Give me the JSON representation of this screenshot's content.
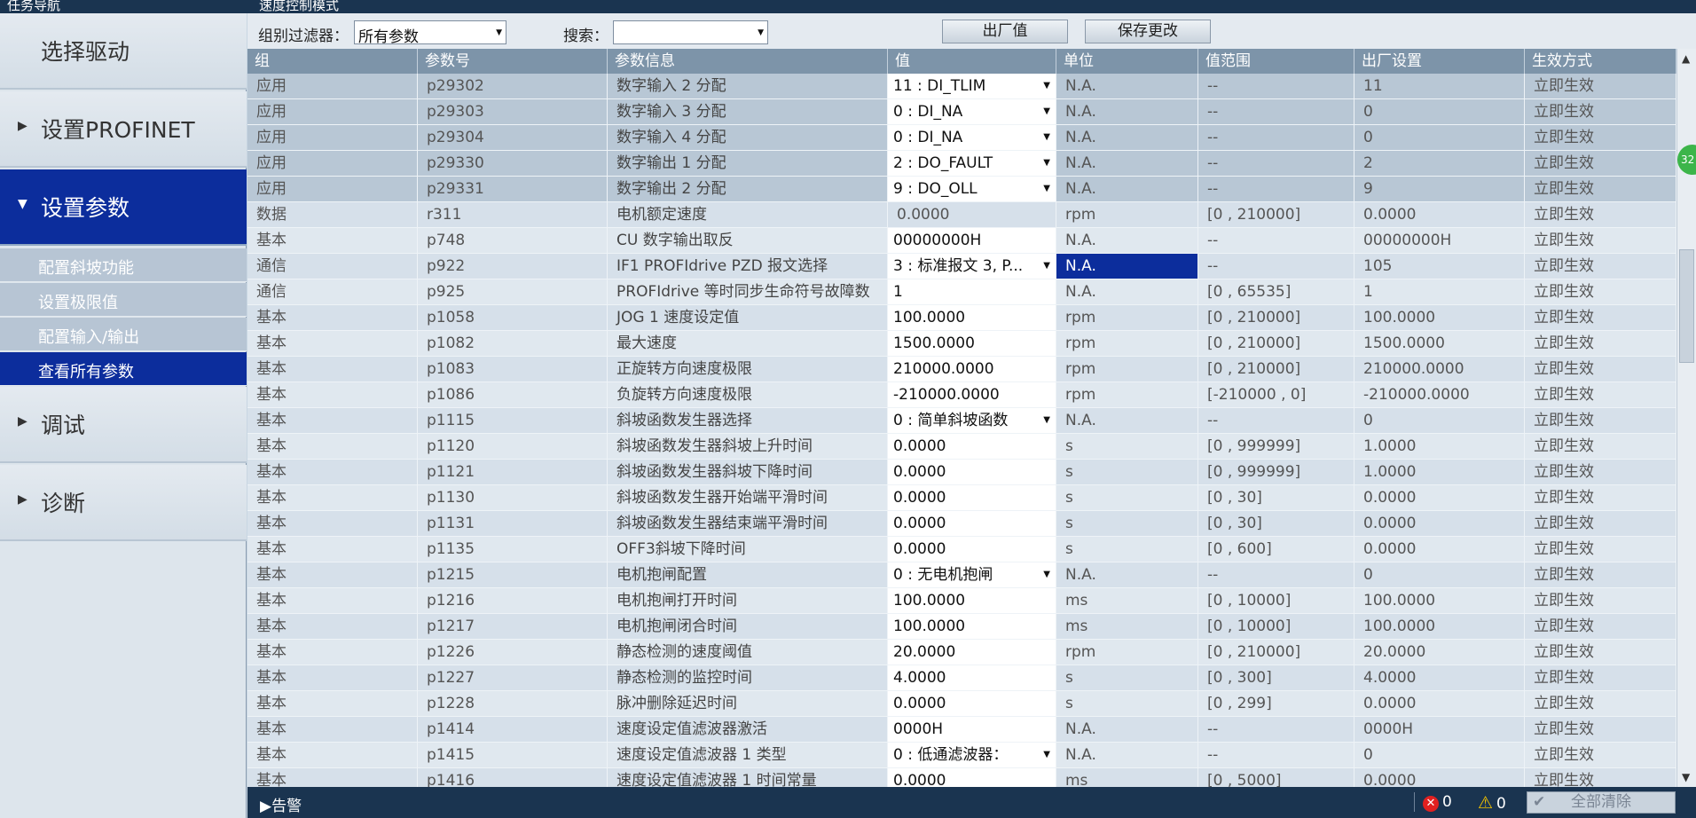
{
  "window": {
    "nav_title": "任务导航",
    "mode_title": "速度控制模式"
  },
  "nav": {
    "main": [
      {
        "label": "选择驱动",
        "arrow": ""
      },
      {
        "label": "设置PROFINET",
        "arrow": "▶"
      },
      {
        "label": "设置参数",
        "arrow": "▼"
      },
      {
        "label": "调试",
        "arrow": "▶"
      },
      {
        "label": "诊断",
        "arrow": "▶"
      }
    ],
    "sub": [
      {
        "label": "配置斜坡功能"
      },
      {
        "label": "设置极限值"
      },
      {
        "label": "配置输入/输出"
      },
      {
        "label": "查看所有参数"
      }
    ]
  },
  "toolbar": {
    "group_filter_label": "组别过滤器：",
    "group_filter_value": "所有参数",
    "search_label": "搜索：",
    "search_value": "",
    "factory_button": "出厂值",
    "save_button": "保存更改"
  },
  "table": {
    "headers": [
      "组",
      "参数号",
      "参数信息",
      "值",
      "单位",
      "值范围",
      "出厂设置",
      "生效方式"
    ],
    "rows": [
      {
        "group": "应用",
        "param": "p29302",
        "info": "数字输入 2 分配",
        "value": "11 : DI_TLIM",
        "combo": true,
        "unit": "N.A.",
        "range": "--",
        "factory": "11",
        "effect": "立即生效"
      },
      {
        "group": "应用",
        "param": "p29303",
        "info": "数字输入 3 分配",
        "value": "0 : DI_NA",
        "combo": true,
        "unit": "N.A.",
        "range": "--",
        "factory": "0",
        "effect": "立即生效"
      },
      {
        "group": "应用",
        "param": "p29304",
        "info": "数字输入 4 分配",
        "value": "0 : DI_NA",
        "combo": true,
        "unit": "N.A.",
        "range": "--",
        "factory": "0",
        "effect": "立即生效"
      },
      {
        "group": "应用",
        "param": "p29330",
        "info": "数字输出 1 分配",
        "value": "2 : DO_FAULT",
        "combo": true,
        "unit": "N.A.",
        "range": "--",
        "factory": "2",
        "effect": "立即生效"
      },
      {
        "group": "应用",
        "param": "p29331",
        "info": "数字输出 2 分配",
        "value": "9 : DO_OLL",
        "combo": true,
        "unit": "N.A.",
        "range": "--",
        "factory": "9",
        "effect": "立即生效"
      },
      {
        "group": "数据",
        "param": "r311",
        "info": "电机额定速度",
        "value": "0.0000",
        "combo": false,
        "readonly": true,
        "unit": "rpm",
        "range": "[0 , 210000]",
        "factory": "0.0000",
        "effect": "立即生效"
      },
      {
        "group": "基本",
        "param": "p748",
        "info": "CU 数字输出取反",
        "value": "00000000H",
        "combo": false,
        "unit": "N.A.",
        "range": "--",
        "factory": "00000000H",
        "effect": "立即生效"
      },
      {
        "group": "通信",
        "param": "p922",
        "info": "IF1 PROFIdrive PZD 报文选择",
        "value": "3 : 标准报文 3, P...",
        "combo": true,
        "unit": "N.A.",
        "unit_selected": true,
        "range": "--",
        "factory": "105",
        "effect": "立即生效"
      },
      {
        "group": "通信",
        "param": "p925",
        "info": "PROFIdrive 等时同步生命符号故障数",
        "value": "1",
        "combo": false,
        "unit": "N.A.",
        "range": "[0 , 65535]",
        "factory": "1",
        "effect": "立即生效"
      },
      {
        "group": "基本",
        "param": "p1058",
        "info": "JOG 1 速度设定值",
        "value": "100.0000",
        "combo": false,
        "unit": "rpm",
        "range": "[0 , 210000]",
        "factory": "100.0000",
        "effect": "立即生效"
      },
      {
        "group": "基本",
        "param": "p1082",
        "info": "最大速度",
        "value": "1500.0000",
        "combo": false,
        "unit": "rpm",
        "range": "[0 , 210000]",
        "factory": "1500.0000",
        "effect": "立即生效"
      },
      {
        "group": "基本",
        "param": "p1083",
        "info": "正旋转方向速度极限",
        "value": "210000.0000",
        "combo": false,
        "unit": "rpm",
        "range": "[0 , 210000]",
        "factory": "210000.0000",
        "effect": "立即生效"
      },
      {
        "group": "基本",
        "param": "p1086",
        "info": "负旋转方向速度极限",
        "value": "-210000.0000",
        "combo": false,
        "unit": "rpm",
        "range": "[-210000 , 0]",
        "factory": "-210000.0000",
        "effect": "立即生效"
      },
      {
        "group": "基本",
        "param": "p1115",
        "info": "斜坡函数发生器选择",
        "value": "0 : 简单斜坡函数",
        "combo": true,
        "unit": "N.A.",
        "range": "--",
        "factory": "0",
        "effect": "立即生效"
      },
      {
        "group": "基本",
        "param": "p1120",
        "info": "斜坡函数发生器斜坡上升时间",
        "value": "0.0000",
        "combo": false,
        "unit": "s",
        "range": "[0 , 999999]",
        "factory": "1.0000",
        "effect": "立即生效"
      },
      {
        "group": "基本",
        "param": "p1121",
        "info": "斜坡函数发生器斜坡下降时间",
        "value": "0.0000",
        "combo": false,
        "unit": "s",
        "range": "[0 , 999999]",
        "factory": "1.0000",
        "effect": "立即生效"
      },
      {
        "group": "基本",
        "param": "p1130",
        "info": "斜坡函数发生器开始端平滑时间",
        "value": "0.0000",
        "combo": false,
        "unit": "s",
        "range": "[0 , 30]",
        "factory": "0.0000",
        "effect": "立即生效"
      },
      {
        "group": "基本",
        "param": "p1131",
        "info": "斜坡函数发生器结束端平滑时间",
        "value": "0.0000",
        "combo": false,
        "unit": "s",
        "range": "[0 , 30]",
        "factory": "0.0000",
        "effect": "立即生效"
      },
      {
        "group": "基本",
        "param": "p1135",
        "info": "OFF3斜坡下降时间",
        "value": "0.0000",
        "combo": false,
        "unit": "s",
        "range": "[0 , 600]",
        "factory": "0.0000",
        "effect": "立即生效"
      },
      {
        "group": "基本",
        "param": "p1215",
        "info": "电机抱闸配置",
        "value": "0 : 无电机抱闸",
        "combo": true,
        "unit": "N.A.",
        "range": "--",
        "factory": "0",
        "effect": "立即生效"
      },
      {
        "group": "基本",
        "param": "p1216",
        "info": "电机抱闸打开时间",
        "value": "100.0000",
        "combo": false,
        "unit": "ms",
        "range": "[0 , 10000]",
        "factory": "100.0000",
        "effect": "立即生效"
      },
      {
        "group": "基本",
        "param": "p1217",
        "info": "电机抱闸闭合时间",
        "value": "100.0000",
        "combo": false,
        "unit": "ms",
        "range": "[0 , 10000]",
        "factory": "100.0000",
        "effect": "立即生效"
      },
      {
        "group": "基本",
        "param": "p1226",
        "info": "静态检测的速度阈值",
        "value": "20.0000",
        "combo": false,
        "unit": "rpm",
        "range": "[0 , 210000]",
        "factory": "20.0000",
        "effect": "立即生效"
      },
      {
        "group": "基本",
        "param": "p1227",
        "info": "静态检测的监控时间",
        "value": "4.0000",
        "combo": false,
        "unit": "s",
        "range": "[0 , 300]",
        "factory": "4.0000",
        "effect": "立即生效"
      },
      {
        "group": "基本",
        "param": "p1228",
        "info": "脉冲删除延迟时间",
        "value": "0.0000",
        "combo": false,
        "unit": "s",
        "range": "[0 , 299]",
        "factory": "0.0000",
        "effect": "立即生效"
      },
      {
        "group": "基本",
        "param": "p1414",
        "info": "速度设定值滤波器激活",
        "value": "0000H",
        "combo": false,
        "unit": "N.A.",
        "range": "--",
        "factory": "0000H",
        "effect": "立即生效"
      },
      {
        "group": "基本",
        "param": "p1415",
        "info": "速度设定值滤波器 1 类型",
        "value": "0 : 低通滤波器：",
        "combo": true,
        "unit": "N.A.",
        "range": "--",
        "factory": "0",
        "effect": "立即生效"
      },
      {
        "group": "基本",
        "param": "p1416",
        "info": "速度设定值滤波器 1 时间常量",
        "value": "0.0000",
        "combo": false,
        "unit": "ms",
        "range": "[0 , 5000]",
        "factory": "0.0000",
        "effect": "立即生效"
      }
    ]
  },
  "badge": {
    "text": "32"
  },
  "status": {
    "alarm_label": "告警",
    "error_count": "0",
    "warning_count": "0",
    "clear_all": "全部清除"
  },
  "colors": {
    "nav_active": "#0c2d9c",
    "header": "#7d94a9",
    "status_bar": "#1a3450"
  }
}
